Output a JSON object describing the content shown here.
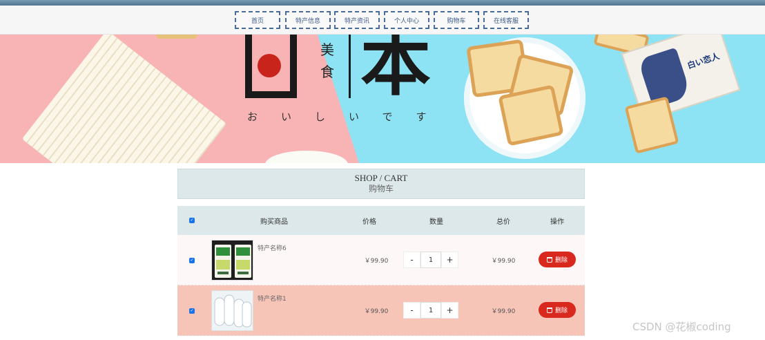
{
  "nav": {
    "items": [
      {
        "label": "首页"
      },
      {
        "label": "特产信息"
      },
      {
        "label": "特产资讯"
      },
      {
        "label": "个人中心"
      },
      {
        "label": "购物车"
      },
      {
        "label": "在线客服"
      }
    ]
  },
  "banner": {
    "meishi": "美食",
    "ben": "本",
    "kana": "おいしいです",
    "pack_label": "白い恋人",
    "slides": 3,
    "active_slide": 1
  },
  "page_title": {
    "en": "SHOP / CART",
    "cn": "购物车"
  },
  "cart": {
    "headers": {
      "product": "购买商品",
      "price": "价格",
      "qty": "数量",
      "total": "总价",
      "action": "操作"
    },
    "select_all": true,
    "rows": [
      {
        "name": "特产名称6",
        "price": "￥99.90",
        "qty": "1",
        "total": "￥99.90",
        "checked": true
      },
      {
        "name": "特产名称1",
        "price": "￥99.90",
        "qty": "1",
        "total": "￥99.90",
        "checked": true
      }
    ],
    "minus": "-",
    "plus": "+",
    "delete_label": "删除"
  },
  "watermark": "CSDN @花椒coding",
  "colors": {
    "nav_border": "#4a6a9a",
    "banner_pink": "#f8b4b4",
    "banner_blue": "#8de3f3",
    "header_bg": "#dde8ea",
    "delete_red": "#d9281e",
    "row2_bg": "#f7c4b8"
  }
}
